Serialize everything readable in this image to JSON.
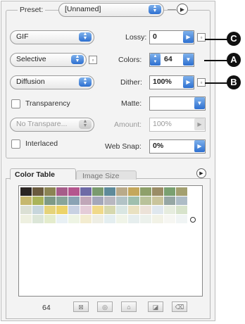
{
  "preset": {
    "label": "Preset:",
    "value": "[Unnamed]"
  },
  "format": {
    "value": "GIF"
  },
  "reduction": {
    "value": "Selective"
  },
  "dither_algorithm": {
    "value": "Diffusion"
  },
  "transparency": {
    "label": "Transparency",
    "checked": false
  },
  "transparency_dither": {
    "value": "No Transpare..."
  },
  "interlaced": {
    "label": "Interlaced",
    "checked": false
  },
  "lossy": {
    "label": "Lossy:",
    "value": "0"
  },
  "colors": {
    "label": "Colors:",
    "value": "64"
  },
  "dither": {
    "label": "Dither:",
    "value": "100%"
  },
  "matte": {
    "label": "Matte:",
    "value": ""
  },
  "amount": {
    "label": "Amount:",
    "value": "100%"
  },
  "web_snap": {
    "label": "Web Snap:",
    "value": "0%"
  },
  "callouts": {
    "a": "A",
    "b": "B",
    "c": "C"
  },
  "tabs": [
    {
      "label": "Color Table"
    },
    {
      "label": "Image Size"
    }
  ],
  "color_count": "64",
  "swatch_colors": [
    "#2a2522",
    "#6a5a3e",
    "#8b8453",
    "#a65d8a",
    "#b4568e",
    "#6e6aa6",
    "#7a9a6e",
    "#5e8a9a",
    "#b9aa8a",
    "#c4a75c",
    "#8ea06a",
    "#9a8c66",
    "#7aa070",
    "#a3a070",
    "#c6b86e",
    "#aab45a",
    "#7e9a86",
    "#88a59a",
    "#8aa3b4",
    "#c0a6b8",
    "#a4a7ba",
    "#b8b7c0",
    "#b2c3c6",
    "#9fbfae",
    "#b9c29a",
    "#c9c49c",
    "#96a7a4",
    "#adbcc6",
    "#dbe0d4",
    "#c7d6dc",
    "#e5d37a",
    "#ecd36a",
    "#c8d1e2",
    "#e4ccd8",
    "#f0d98a",
    "#d6d8ae",
    "#d9e6e2",
    "#e9e1c1",
    "#ece2d8",
    "#dfe7ee",
    "#e6ecde",
    "#d7e3cb",
    "#eef0e0",
    "#dce6d8",
    "#e4eccc",
    "#e8f0f4",
    "#eef4e4",
    "#f3ecd0",
    "#eeeee4",
    "#e4eef0",
    "#f0f4e8",
    "#e6eeee",
    "#ecf1ec",
    "#f2f2e6",
    "#f6f6f2",
    "#f0f4f4"
  ],
  "icons": {
    "panel_menu": "circle-arrow-icon",
    "color_table_menu": "circle-arrow-icon",
    "bottom_buttons": [
      "web-shift-icon",
      "lock-icon",
      "add-color-icon",
      "new-swatch-icon",
      "trash-icon"
    ]
  }
}
